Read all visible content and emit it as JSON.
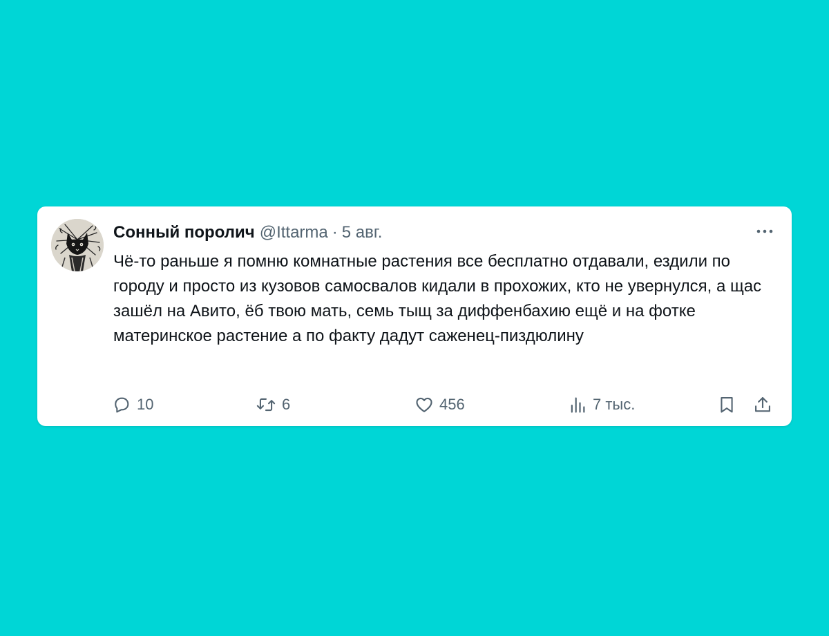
{
  "tweet": {
    "author": {
      "display_name": "Сонный поролич",
      "handle": "@Ittarma"
    },
    "separator": "·",
    "date": "5 авг.",
    "more_icon": "more-horizontal-icon",
    "text": "Чё-то раньше я помню комнатные растения все бесплатно отдавали, ездили по городу и просто из кузовов самосвалов кидали в прохожих, кто не увернулся, а щас зашёл на Авито, ёб твою мать, семь тыщ за диффенбахию ещё и на фотке материнское растение а по факту дадут саженец-пиздюлину",
    "stats": {
      "replies": "10",
      "retweets": "6",
      "likes": "456",
      "views": "7 тыс."
    },
    "icons": {
      "reply": "reply-bubble-icon",
      "retweet": "retweet-icon",
      "like": "heart-icon",
      "views": "views-bar-chart-icon",
      "bookmark": "bookmark-icon",
      "share": "share-upload-icon"
    }
  },
  "colors": {
    "background": "#00d6d6",
    "card": "#ffffff",
    "primary_text": "#0f1419",
    "secondary_text": "#536471"
  }
}
